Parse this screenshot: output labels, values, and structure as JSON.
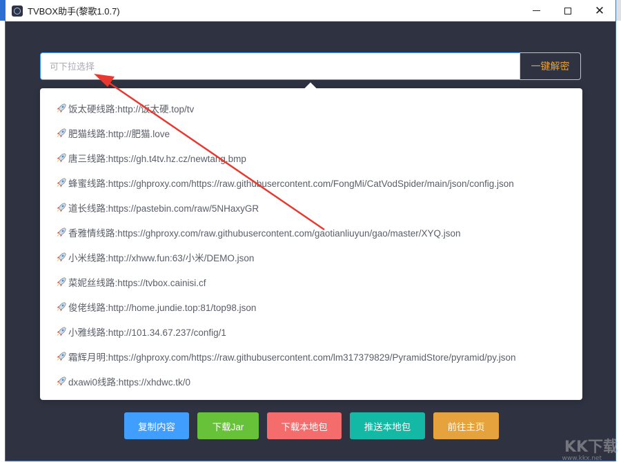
{
  "window": {
    "title": "TVBOX助手(黎歌1.0.7)",
    "minimize_glyph": "",
    "maximize_glyph": "",
    "close_glyph": "✕"
  },
  "search": {
    "placeholder": "可下拉选择",
    "value": "",
    "decode_label": "一键解密"
  },
  "dropdown": {
    "options": [
      "饭太硬线路:http://饭太硬.top/tv",
      "肥猫线路:http://肥猫.love",
      "唐三线路:https://gh.t4tv.hz.cz/newtang.bmp",
      "蜂蜜线路:https://ghproxy.com/https://raw.githubusercontent.com/FongMi/CatVodSpider/main/json/config.json",
      "道长线路:https://pastebin.com/raw/5NHaxyGR",
      "香雅情线路:https://ghproxy.com/raw.githubusercontent.com/gaotianliuyun/gao/master/XYQ.json",
      "小米线路:http://xhww.fun:63/小米/DEMO.json",
      "菜妮丝线路:https://tvbox.cainisi.cf",
      "俊佬线路:http://home.jundie.top:81/top98.json",
      "小雅线路:http://101.34.67.237/config/1",
      "霜辉月明:https://ghproxy.com/https://raw.githubusercontent.com/lm317379829/PyramidStore/pyramid/py.json",
      "dxawi0线路:https://xhdwc.tk/0"
    ]
  },
  "actions": [
    {
      "label": "复制内容",
      "color": "#409eff"
    },
    {
      "label": "下载Jar",
      "color": "#67c23a"
    },
    {
      "label": "下载本地包",
      "color": "#f56c6c"
    },
    {
      "label": "推送本地包",
      "color": "#13b9a4"
    },
    {
      "label": "前往主页",
      "color": "#e6a23c"
    }
  ],
  "colors": {
    "window_bg": "#2f3341",
    "accent": "#409eff",
    "annotation_arrow": "#e8382f"
  },
  "icons": {
    "option_icon": "rocket-icon"
  },
  "watermark": {
    "text": "KK下载",
    "sub": "www.kkx.net"
  }
}
